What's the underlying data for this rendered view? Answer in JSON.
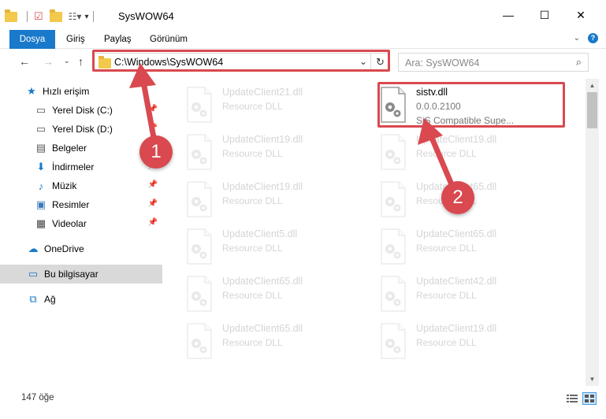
{
  "window": {
    "title": "SysWOW64",
    "minimize": "—",
    "maximize": "☐",
    "close": "✕"
  },
  "ribbon": {
    "tabs": [
      "Dosya",
      "Giriş",
      "Paylaş",
      "Görünüm"
    ]
  },
  "address": {
    "path": "C:\\Windows\\SysWOW64",
    "search_placeholder": "Ara: SysWOW64"
  },
  "sidebar": {
    "quick_access": "Hızlı erişim",
    "items": [
      {
        "label": "Yerel Disk (C:)",
        "icon": "drive-icon",
        "pinned": true
      },
      {
        "label": "Yerel Disk (D:)",
        "icon": "drive-icon",
        "pinned": true
      },
      {
        "label": "Belgeler",
        "icon": "documents-icon",
        "pinned": true
      },
      {
        "label": "İndirmeler",
        "icon": "download-icon",
        "pinned": true
      },
      {
        "label": "Müzik",
        "icon": "music-icon",
        "pinned": true
      },
      {
        "label": "Resimler",
        "icon": "pictures-icon",
        "pinned": true
      },
      {
        "label": "Videolar",
        "icon": "video-icon",
        "pinned": true
      }
    ],
    "onedrive": "OneDrive",
    "this_pc": "Bu bilgisayar",
    "network": "Ağ"
  },
  "files": [
    {
      "name": "UpdateClient21.dll",
      "type": "Resource DLL",
      "faded": true
    },
    {
      "name": "sistv.dll",
      "type": "0.0.0.2100",
      "desc": "SiS Compatible Supe...",
      "faded": false
    },
    {
      "name": "UpdateClient19.dll",
      "type": "Resource DLL",
      "faded": true
    },
    {
      "name": "UpdateClient19.dll",
      "type": "Resource DLL",
      "faded": true
    },
    {
      "name": "UpdateClient19.dll",
      "type": "Resource DLL",
      "faded": true
    },
    {
      "name": "UpdateClient65.dll",
      "type": "Resource DLL",
      "faded": true
    },
    {
      "name": "UpdateClient5.dll",
      "type": "Resource DLL",
      "faded": true
    },
    {
      "name": "UpdateClient65.dll",
      "type": "Resource DLL",
      "faded": true
    },
    {
      "name": "UpdateClient65.dll",
      "type": "Resource DLL",
      "faded": true
    },
    {
      "name": "UpdateClient42.dll",
      "type": "Resource DLL",
      "faded": true
    },
    {
      "name": "UpdateClient65.dll",
      "type": "Resource DLL",
      "faded": true
    },
    {
      "name": "UpdateClient19.dll",
      "type": "Resource DLL",
      "faded": true
    }
  ],
  "status": {
    "count": "147 öğe"
  },
  "annotations": {
    "marker1": "1",
    "marker2": "2",
    "color": "#d9494f"
  }
}
